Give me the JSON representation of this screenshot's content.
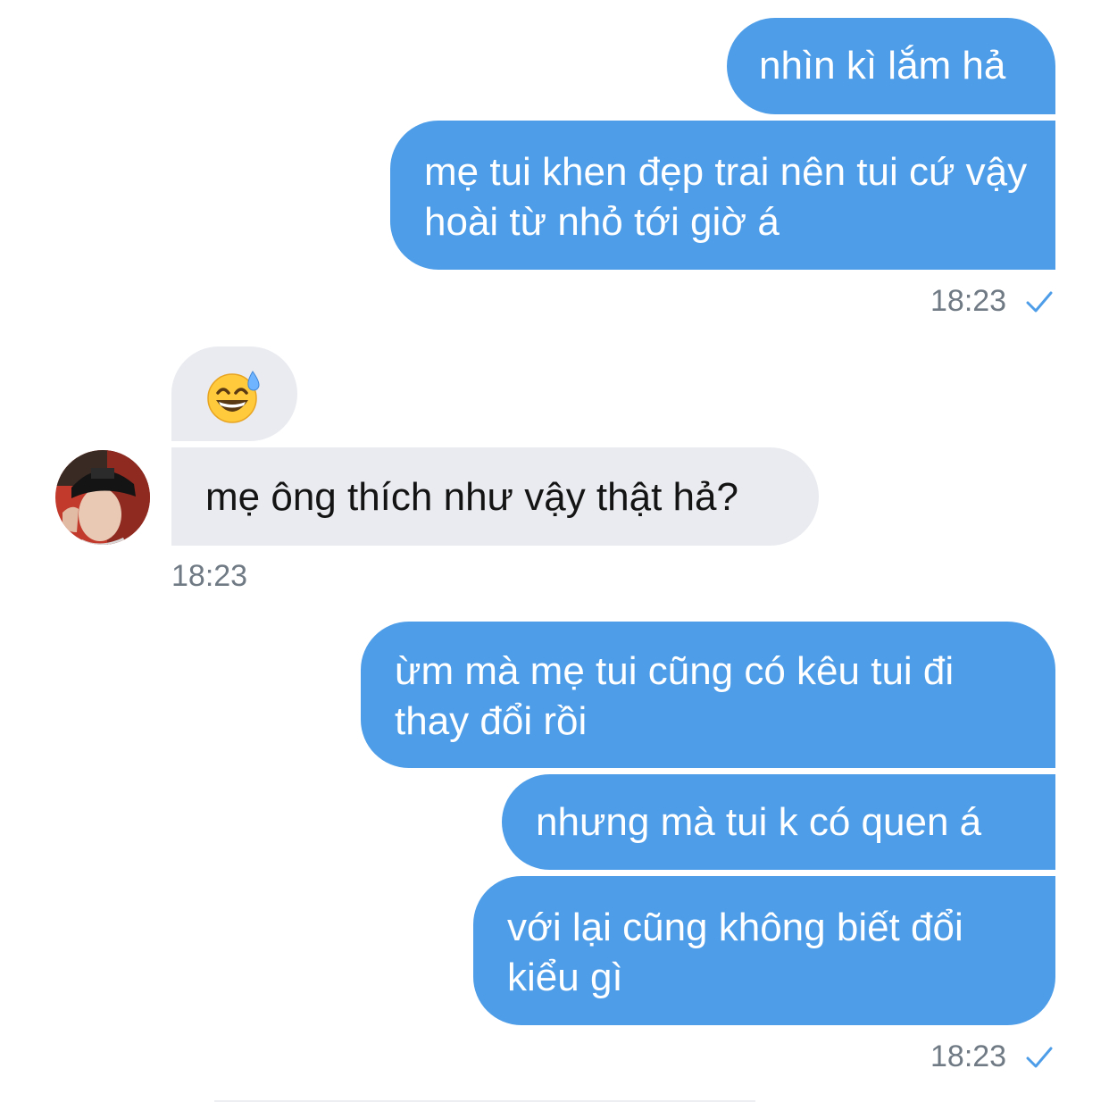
{
  "conversation": {
    "group1": {
      "messages": [
        "nhìn kì lắm hả",
        "mẹ tui khen đẹp trai nên tui cứ vậy hoài từ nhỏ tới giờ á"
      ],
      "time": "18:23",
      "status_icon": "checkmark-icon"
    },
    "group2": {
      "emoji": "😅",
      "message": "mẹ ông thích như vậy thật hả?",
      "time": "18:23",
      "avatar_icon": "contact-avatar"
    },
    "group3": {
      "messages": [
        "ừm mà mẹ tui cũng có kêu tui đi thay đổi rồi",
        "nhưng mà tui k có quen á",
        "với lại cũng không biết đổi kiểu gì"
      ],
      "time": "18:23",
      "status_icon": "checkmark-icon"
    }
  },
  "colors": {
    "outgoing_bubble": "#4d9de8",
    "incoming_bubble": "#e9ebf0",
    "timestamp": "#6f7a85",
    "checkmark": "#4d9de8"
  }
}
